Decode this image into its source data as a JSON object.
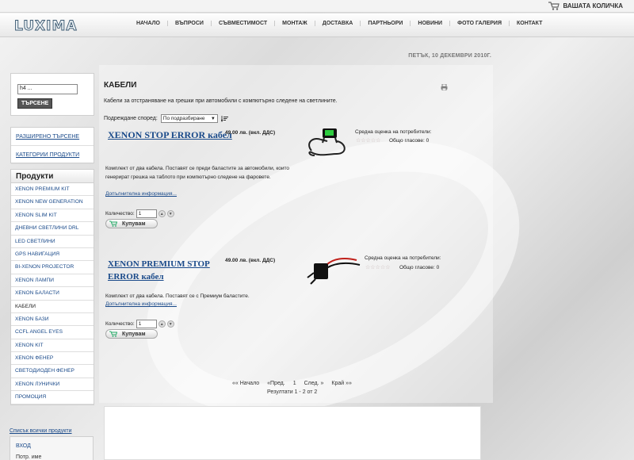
{
  "header": {
    "cart_label": "ВАШАТА КОЛИЧКА",
    "logo_text": "LUXIMA",
    "nav": [
      "НАЧАЛО",
      "ВЪПРОСИ",
      "СЪВМЕСТИМОСТ",
      "МОНТАЖ",
      "ДОСТАВКА",
      "ПАРТНЬОРИ",
      "НОВИНИ",
      "ФОТО ГАЛЕРИЯ",
      "КОНТАКТ"
    ],
    "date": "ПЕТЪК, 10 ДЕКЕМВРИ 2010Г."
  },
  "sidebar": {
    "search_value": "h4 ...",
    "search_button": "ТЪРСЕНЕ",
    "links": [
      "РАЗШИРЕНО ТЪРСЕНЕ",
      "КАТЕГОРИИ ПРОДУКТИ"
    ],
    "products_title": "Продукти",
    "products": [
      "XENON PREMIUM KIT",
      "XENON NEW GENERATION",
      "XENON SLIM KIT",
      "ДНЕВНИ СВЕТЛИНИ DRL",
      "LED СВЕТЛИНИ",
      "GPS НАВИГАЦИЯ",
      "BI-XENON PROJECTOR",
      "XENON ЛАМПИ",
      "XENON БАЛАСТИ",
      "КАБЕЛИ",
      "XENON БАЗИ",
      "CCFL ANGEL EYES",
      "XENON KIT",
      "XENON ФЕНЕР",
      "СВЕТОДИОДЕН ФЕНЕР",
      "XENON ЛУНИЧКИ",
      "ПРОМОЦИЯ"
    ],
    "active_product": "КАБЕЛИ",
    "all_products_link": "Списък всички продукти",
    "login_label": "ВХОД",
    "login_user_label": "Потр. име"
  },
  "main": {
    "title": "КАБЕЛИ",
    "intro": "Кабели за отстраняване на грешки при автомобили с компютърно следене на светлините.",
    "sort_label": "Подреждане според:",
    "sort_value": "По подразбиране"
  },
  "products": [
    {
      "name": "XENON STOP ERROR кабел",
      "price": "49.00 лв. (вкл. ДДС)",
      "desc": "Комплект от два кабела. Поставят се преди баластите за автомобили, които генерират грешка на таблото при компютърно следене на фаровете.",
      "more": "Допълнителна информация...",
      "rating_label": "Средна оценка на потребители:",
      "stars": "☆☆☆☆☆",
      "votes": "Общо гласове: 0",
      "qty_label": "Количество:",
      "qty": "1",
      "buy": "Купувам"
    },
    {
      "name": "XENON PREMIUM STOP ERROR кабел",
      "price": "49.00 лв. (вкл. ДДС)",
      "desc": "Комплект от два кабела. Поставят се с Премиум баластите.",
      "more": "Допълнителна информация...",
      "rating_label": "Средна оценка на потребители:",
      "stars": "☆☆☆☆☆",
      "votes": "Общо гласове: 0",
      "qty_label": "Количество:",
      "qty": "1",
      "buy": "Купувам"
    }
  ],
  "pagination": {
    "start": "«« Начало",
    "prev": "«Пред.",
    "page": "1",
    "next": "След. »",
    "end": "Край »»",
    "results": "Резултати 1 - 2 от 2"
  }
}
